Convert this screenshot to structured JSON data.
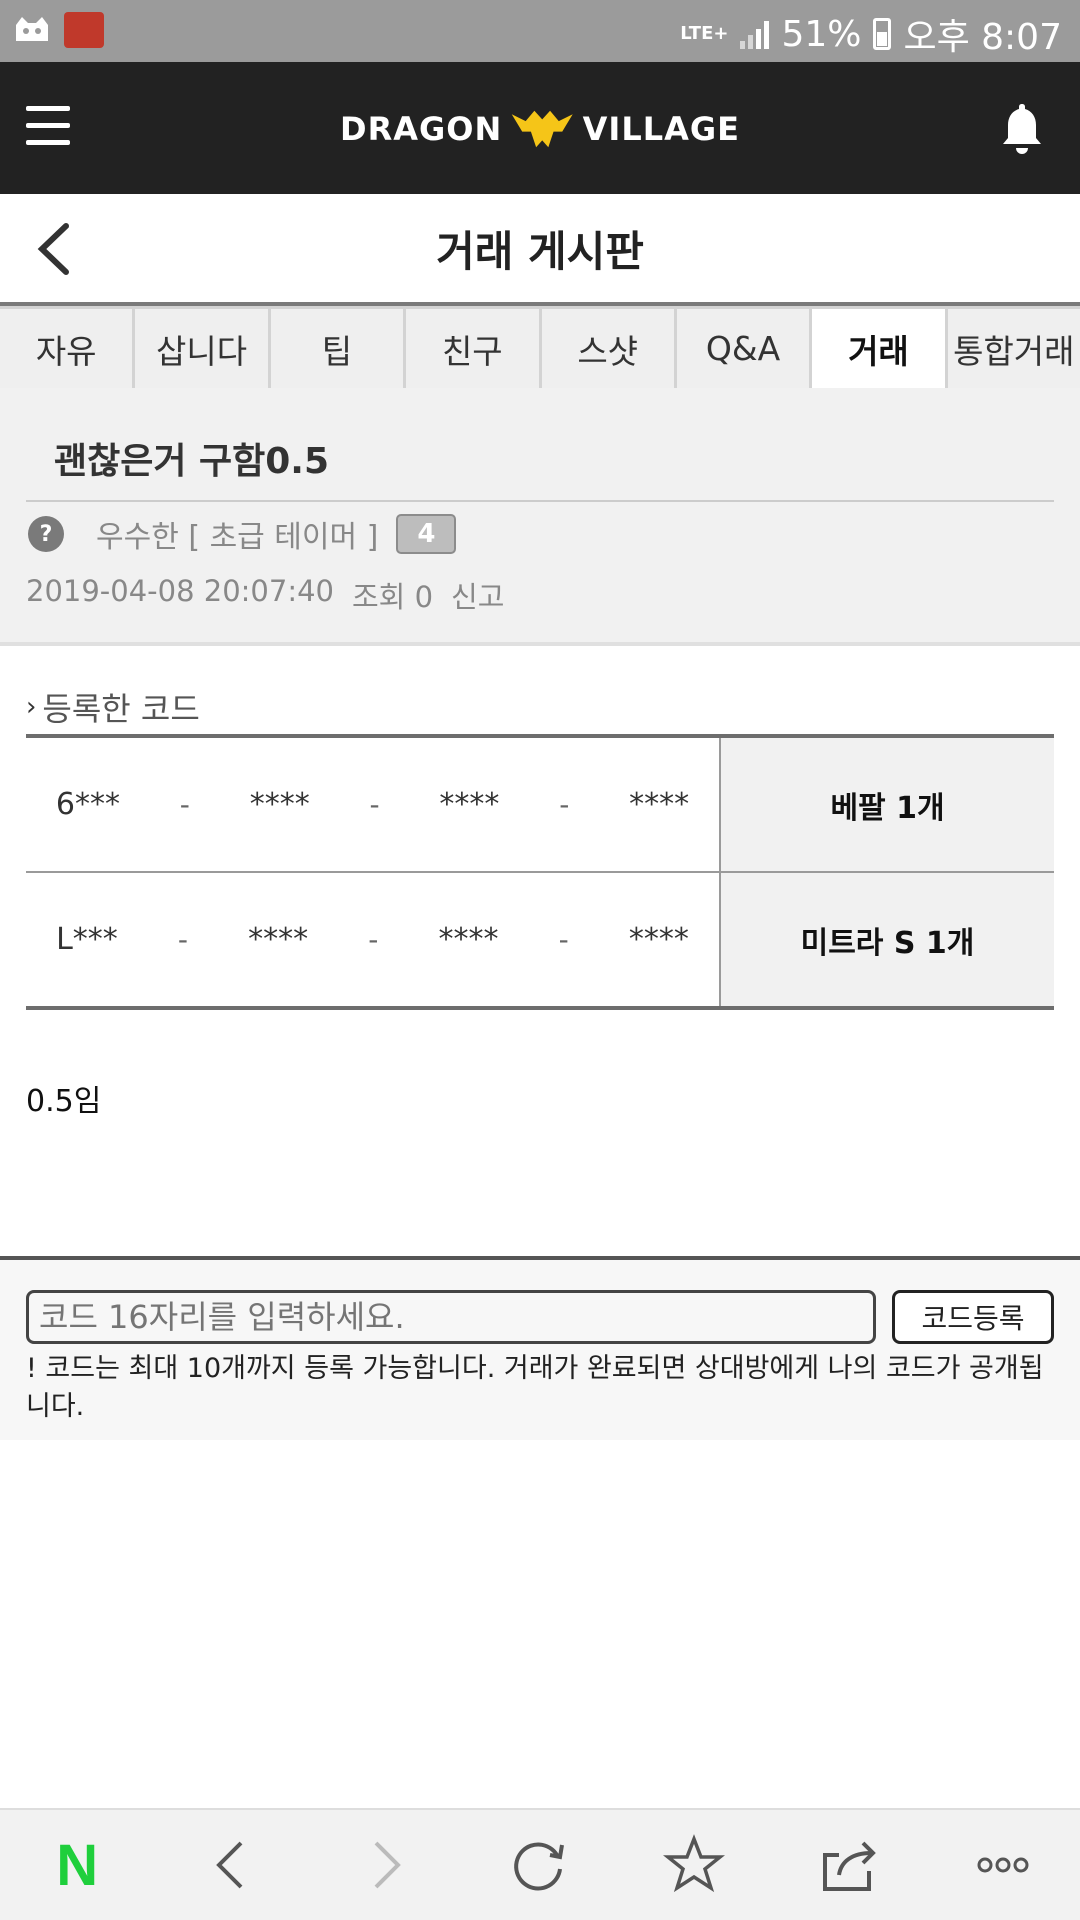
{
  "status_bar": {
    "network": "LTE+",
    "battery": "51%",
    "time": "오후 8:07"
  },
  "app_bar": {
    "logo_left": "DRAGON",
    "logo_right": "VILLAGE",
    "icons": [
      "menu-icon",
      "bell-icon"
    ]
  },
  "title_bar": {
    "title": "거래 게시판"
  },
  "tabs": [
    {
      "label": "자유"
    },
    {
      "label": "삽니다"
    },
    {
      "label": "팁"
    },
    {
      "label": "친구"
    },
    {
      "label": "스샷"
    },
    {
      "label": "Q&A"
    },
    {
      "label": "거래",
      "active": true
    },
    {
      "label": "통합거래"
    }
  ],
  "post": {
    "title": "괜찮은거 구함0.5",
    "author": "우수한 [ 초급 테이머 ]",
    "level": "4",
    "question_mark": "?",
    "date": "2019-04-08 20:07:40",
    "views": "조회 0",
    "report": "신고"
  },
  "codes_section": {
    "label": "등록한 코드",
    "chevron": "›",
    "dash": "-",
    "rows": [
      {
        "parts": [
          "6***",
          "****",
          "****",
          "****"
        ],
        "item": "베팔 1개"
      },
      {
        "parts": [
          "L***",
          "****",
          "****",
          "****"
        ],
        "item": "미트라 S 1개"
      }
    ]
  },
  "post_body": "0.5임",
  "comment": {
    "placeholder": "코드 16자리를 입력하세요.",
    "button": "코드등록",
    "notice": "! 코드는 최대 10개까지 등록 가능합니다. 거래가 완료되면 상대방에게 나의 코드가 공개됩니다."
  },
  "browser_bar": {
    "logo": "N",
    "icons": [
      "naver-logo-icon",
      "back-icon",
      "forward-icon",
      "refresh-icon",
      "bookmark-star-icon",
      "share-icon",
      "more-icon"
    ]
  }
}
